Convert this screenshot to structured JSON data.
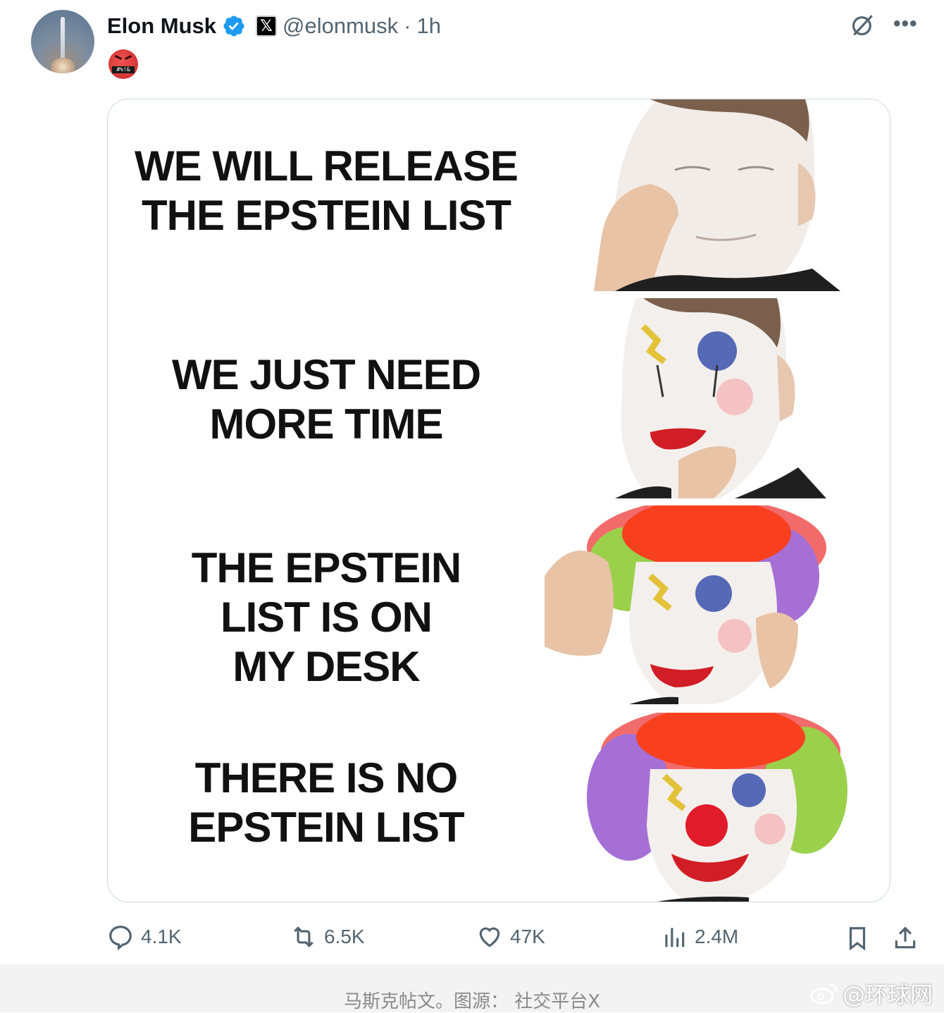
{
  "tweet": {
    "author_name": "Elon Musk",
    "handle": "@elonmusk",
    "separator": "·",
    "time": "1h",
    "x_badge": "𝕏",
    "emoji_text": "#%!&",
    "emoji_icon": "face-with-symbols-over-mouth-icon"
  },
  "meme": {
    "panels": [
      {
        "line1": "WE WILL RELEASE",
        "line2": "THE EPSTEIN LIST",
        "line3": ""
      },
      {
        "line1": "WE JUST NEED",
        "line2": "MORE TIME",
        "line3": ""
      },
      {
        "line1": "THE EPSTEIN",
        "line2": "LIST IS ON",
        "line3": "MY DESK"
      },
      {
        "line1": "THERE IS NO",
        "line2": "EPSTEIN LIST",
        "line3": ""
      }
    ]
  },
  "actions": {
    "replies": "4.1K",
    "reposts": "6.5K",
    "likes": "47K",
    "views": "2.4M"
  },
  "footer": {
    "caption": "马斯克帖文。图源： 社交平台X",
    "watermark": "@环球网"
  },
  "colors": {
    "verified_blue": "#1d9bf0",
    "text_secondary": "#536471",
    "border": "#cfd9de"
  }
}
